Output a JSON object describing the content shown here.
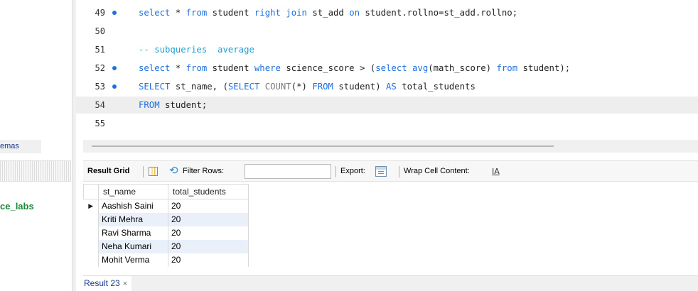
{
  "sidebar": {
    "tab_label": "emas",
    "schema_name": "ce_labs"
  },
  "editor": {
    "lines": [
      {
        "number": "49",
        "has_dot": true,
        "tokens": [
          {
            "t": "kw",
            "v": "select"
          },
          {
            "t": "id",
            "v": " * "
          },
          {
            "t": "kw",
            "v": "from"
          },
          {
            "t": "id",
            "v": " student "
          },
          {
            "t": "kw",
            "v": "right join"
          },
          {
            "t": "id",
            "v": " st_add "
          },
          {
            "t": "kw",
            "v": "on"
          },
          {
            "t": "id",
            "v": " student.rollno=st_add.rollno;"
          }
        ]
      },
      {
        "number": "50",
        "has_dot": false,
        "tokens": []
      },
      {
        "number": "51",
        "has_dot": false,
        "tokens": [
          {
            "t": "cm",
            "v": "-- subqueries  average"
          }
        ]
      },
      {
        "number": "52",
        "has_dot": true,
        "tokens": [
          {
            "t": "kw",
            "v": "select"
          },
          {
            "t": "id",
            "v": " * "
          },
          {
            "t": "kw",
            "v": "from"
          },
          {
            "t": "id",
            "v": " student "
          },
          {
            "t": "kw",
            "v": "where"
          },
          {
            "t": "id",
            "v": " science_score > ("
          },
          {
            "t": "kw",
            "v": "select"
          },
          {
            "t": "id",
            "v": " "
          },
          {
            "t": "kw",
            "v": "avg"
          },
          {
            "t": "id",
            "v": "(math_score) "
          },
          {
            "t": "kw",
            "v": "from"
          },
          {
            "t": "id",
            "v": " student);"
          }
        ]
      },
      {
        "number": "53",
        "has_dot": true,
        "tokens": [
          {
            "t": "kw",
            "v": "SELECT"
          },
          {
            "t": "id",
            "v": " st_name, ("
          },
          {
            "t": "kw",
            "v": "SELECT"
          },
          {
            "t": "id",
            "v": " "
          },
          {
            "t": "fn",
            "v": "COUNT"
          },
          {
            "t": "id",
            "v": "(*) "
          },
          {
            "t": "kw",
            "v": "FROM"
          },
          {
            "t": "id",
            "v": " student) "
          },
          {
            "t": "kw",
            "v": "AS"
          },
          {
            "t": "id",
            "v": " total_students"
          }
        ]
      },
      {
        "number": "54",
        "has_dot": false,
        "current": true,
        "tokens": [
          {
            "t": "kw",
            "v": "FROM"
          },
          {
            "t": "id",
            "v": " student;"
          }
        ]
      },
      {
        "number": "55",
        "has_dot": false,
        "tokens": []
      }
    ]
  },
  "toolbar": {
    "result_grid_label": "Result Grid",
    "filter_label": "Filter Rows:",
    "filter_value": "",
    "export_label": "Export:",
    "wrap_label": "Wrap Cell Content:",
    "wrap_icon_glyph": "IA"
  },
  "grid": {
    "columns": [
      "st_name",
      "total_students"
    ],
    "rows": [
      {
        "marker": "▶",
        "cells": [
          "Aashish Saini",
          "20"
        ]
      },
      {
        "marker": "",
        "cells": [
          "Kriti Mehra",
          "20"
        ]
      },
      {
        "marker": "",
        "cells": [
          "Ravi Sharma",
          "20"
        ]
      },
      {
        "marker": "",
        "cells": [
          "Neha Kumari",
          "20"
        ]
      },
      {
        "marker": "",
        "cells": [
          "Mohit Verma",
          "20"
        ]
      }
    ]
  },
  "result_tab": {
    "label": "Result 23",
    "close_glyph": "×"
  },
  "colors": {
    "keyword": "#1e6fe0",
    "comment": "#1e9fd0",
    "schema": "#1a8a3a",
    "row_alt": "#e9f0fa"
  }
}
